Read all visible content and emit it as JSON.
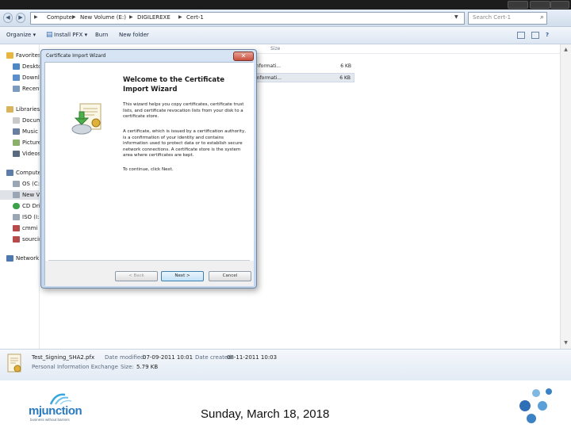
{
  "address_bar": {
    "crumbs": [
      "Computer",
      "New Volume (E:)",
      "DIGILEREXE",
      "Cert-1"
    ],
    "search_placeholder": "Search Cert-1"
  },
  "toolbar": {
    "organize": "Organize",
    "install_pfx": "Install PFX",
    "burn": "Burn",
    "new_folder": "New folder"
  },
  "nav": {
    "favorites": "Favorites",
    "desktop": "Desktop",
    "downloads": "Downloads",
    "recent": "Recent Places",
    "libraries": "Libraries",
    "documents": "Documents",
    "music": "Music",
    "pictures": "Pictures",
    "videos": "Videos",
    "computer": "Computer",
    "c_drive": "OS (C:)",
    "new_volume": "New Volume",
    "cd_drive": "CD Drive",
    "iso": "ISO (I:)",
    "cmmi": "cmmi (J:)",
    "sourcing": "sourcing",
    "network": "Network"
  },
  "filelist": {
    "col_size": "Size",
    "rows": [
      {
        "type": "Informati...",
        "size": "6 KB",
        "selected": false
      },
      {
        "type": "Informati...",
        "size": "6 KB",
        "selected": true
      }
    ]
  },
  "details": {
    "file_name": "Test_Signing_SHA2.pfx",
    "file_type": "Personal Information Exchange",
    "modified_label": "Date modified:",
    "modified_value": "07-09-2011 10:01",
    "created_label": "Date created:",
    "created_value": "08-11-2011 10:03",
    "size_label": "Size:",
    "size_value": "5.79 KB"
  },
  "wizard": {
    "window_title": "Certificate Import Wizard",
    "close": "✕",
    "heading": "Welcome to the Certificate Import Wizard",
    "para1": "This wizard helps you copy certificates, certificate trust lists, and certificate revocation lists from your disk to a certificate store.",
    "para2": "A certificate, which is issued by a certification authority, is a confirmation of your identity and contains information used to protect data or to establish secure network connections. A certificate store is the system area where certificates are kept.",
    "para3": "To continue, click Next.",
    "back": "< Back",
    "next": "Next >",
    "cancel": "Cancel"
  },
  "slide": {
    "logo_text": "mjunction",
    "logo_tagline": "business without barriers",
    "date": "Sunday, March 18, 2018"
  }
}
